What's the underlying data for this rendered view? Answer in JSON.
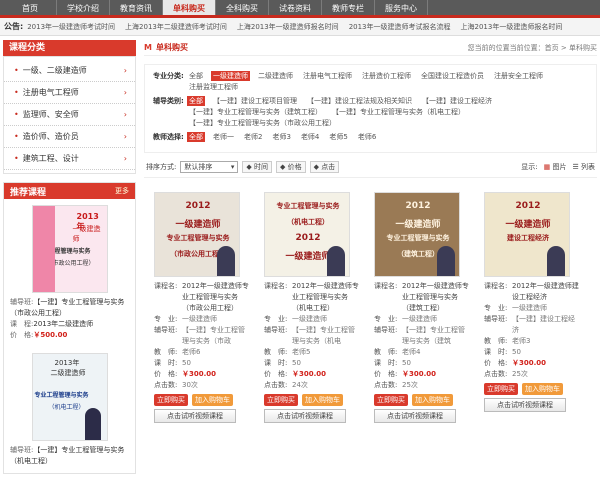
{
  "nav": {
    "items": [
      "首页",
      "学校介绍",
      "教育资讯",
      "单科购买",
      "全科购买",
      "试卷资料",
      "教师专栏",
      "服务中心"
    ],
    "active": 3
  },
  "notice": {
    "label": "公告:",
    "items": [
      "2013年一级建造师考试时间",
      "上海2013年二级建造师考试时间",
      "上海2013年一级建造师报名时间",
      "2013年一级建造师考试报名流程",
      "上海2013年一级建造师报名时间"
    ]
  },
  "sidebar": {
    "title": "课程分类",
    "categories": [
      "一级、二级建造师",
      "注册电气工程师",
      "监理师、安全师",
      "造价师、造价员",
      "建筑工程、设计"
    ]
  },
  "recommend": {
    "title": "推荐课程",
    "more": "更多",
    "items": [
      {
        "cover_lines": [
          "2013年",
          "一级建造师",
          "专业工程管理与实务",
          "（市政公用工程）"
        ],
        "label_tutor": "辅导班:",
        "tutor": "【一建】专业工程管理与实务（市政公用工程）",
        "label_course": "课　程:",
        "course": "2013年二级建造师",
        "label_price": "价　格:",
        "price": "￥500.00"
      },
      {
        "cover_lines": [
          "2013年",
          "二级建造师",
          "专业工程管理与实务",
          "（机电工程）"
        ],
        "label_tutor": "辅导班:",
        "tutor": "【一建】专业工程管理与实务（机电工程）",
        "label_course": "",
        "course": "",
        "label_price": "",
        "price": ""
      }
    ]
  },
  "main": {
    "title": "单科购买",
    "crumb": "您当前的位置当前位置：首页 > 单科购买",
    "filters": [
      {
        "label": "专业分类:",
        "options": [
          "全部",
          "一级建造师",
          "二级建造师",
          "注册电气工程师",
          "注册造价工程师",
          "全国建设工程造价员",
          "注册安全工程师",
          "注册监理工程师"
        ],
        "selected": 1
      },
      {
        "label": "辅导类别:",
        "options": [
          "全部",
          "【一建】建设工程项目管理",
          "【一建】建设工程法规及相关知识",
          "【一建】建设工程经济",
          "【一建】专业工程管理与实务（建筑工程）",
          "【一建】专业工程管理与实务（机电工程）",
          "【一建】专业工程管理与实务（市政公用工程）"
        ],
        "selected": 0
      },
      {
        "label": "教师选择:",
        "options": [
          "全部",
          "老师一",
          "老师2",
          "老师3",
          "老师4",
          "老师5",
          "老师6"
        ],
        "selected": 0
      }
    ],
    "sort": {
      "label": "排序方式:",
      "value": "默认排序",
      "time": "时间",
      "price": "价格",
      "clicks": "点击"
    },
    "display": {
      "label": "显示:",
      "img": "图片",
      "list": "列表"
    },
    "cards": [
      {
        "cover": [
          "2012",
          "一级建造师",
          "专业工程管理与实务",
          "（市政公用工程）"
        ],
        "cover_bg": "#e9e3d9",
        "name_k": "课程名:",
        "name": "2012年一级建造师专业工程管理与实务（市政公用工程）",
        "major_k": "专　业:",
        "major": "一级建造师",
        "tutor_k": "辅导班:",
        "tutor": "【一建】专业工程管理与实务（市政",
        "teacher_k": "教　师:",
        "teacher": "老师6",
        "hours_k": "课　时:",
        "hours": "50",
        "price_k": "价　格:",
        "price": "￥300.00",
        "clicks_k": "点击数:",
        "clicks": "30次",
        "buy": "立即购买",
        "cart": "加入购物车",
        "trial": "点击试听视频课程"
      },
      {
        "cover": [
          "专业工程管理与实务",
          "（机电工程）",
          "2012",
          "一级建造师"
        ],
        "cover_bg": "#f4f1e6",
        "name_k": "课程名:",
        "name": "2012年一级建造师专业工程管理与实务（机电工程）",
        "major_k": "专　业:",
        "major": "一级建造师",
        "tutor_k": "辅导班:",
        "tutor": "【一建】专业工程管理与实务（机电",
        "teacher_k": "教　师:",
        "teacher": "老师5",
        "hours_k": "课　时:",
        "hours": "50",
        "price_k": "价　格:",
        "price": "￥300.00",
        "clicks_k": "点击数:",
        "clicks": "24次",
        "buy": "立即购买",
        "cart": "加入购物车",
        "trial": "点击试听视频课程"
      },
      {
        "cover": [
          "2012",
          "一级建造师",
          "专业工程管理与实务",
          "（建筑工程）"
        ],
        "cover_bg": "#9a7a55",
        "name_k": "课程名:",
        "name": "2012年一级建造师专业工程管理与实务（建筑工程）",
        "major_k": "专　业:",
        "major": "一级建造师",
        "tutor_k": "辅导班:",
        "tutor": "【一建】专业工程管理与实务（建筑",
        "teacher_k": "教　师:",
        "teacher": "老师4",
        "hours_k": "课　时:",
        "hours": "50",
        "price_k": "价　格:",
        "price": "￥300.00",
        "clicks_k": "点击数:",
        "clicks": "25次",
        "buy": "立即购买",
        "cart": "加入购物车",
        "trial": "点击试听视频课程"
      },
      {
        "cover": [
          "2012",
          "一级建造师",
          "建设工程经济"
        ],
        "cover_bg": "#efe6cc",
        "name_k": "课程名:",
        "name": "2012年一级建造师建设工程经济",
        "major_k": "专　业:",
        "major": "一级建造师",
        "tutor_k": "辅导班:",
        "tutor": "【一建】建设工程经济",
        "teacher_k": "教　师:",
        "teacher": "老师3",
        "hours_k": "课　时:",
        "hours": "50",
        "price_k": "价　格:",
        "price": "￥300.00",
        "clicks_k": "点击数:",
        "clicks": "25次",
        "buy": "立即购买",
        "cart": "加入购物车",
        "trial": "点击试听视频课程"
      }
    ]
  }
}
